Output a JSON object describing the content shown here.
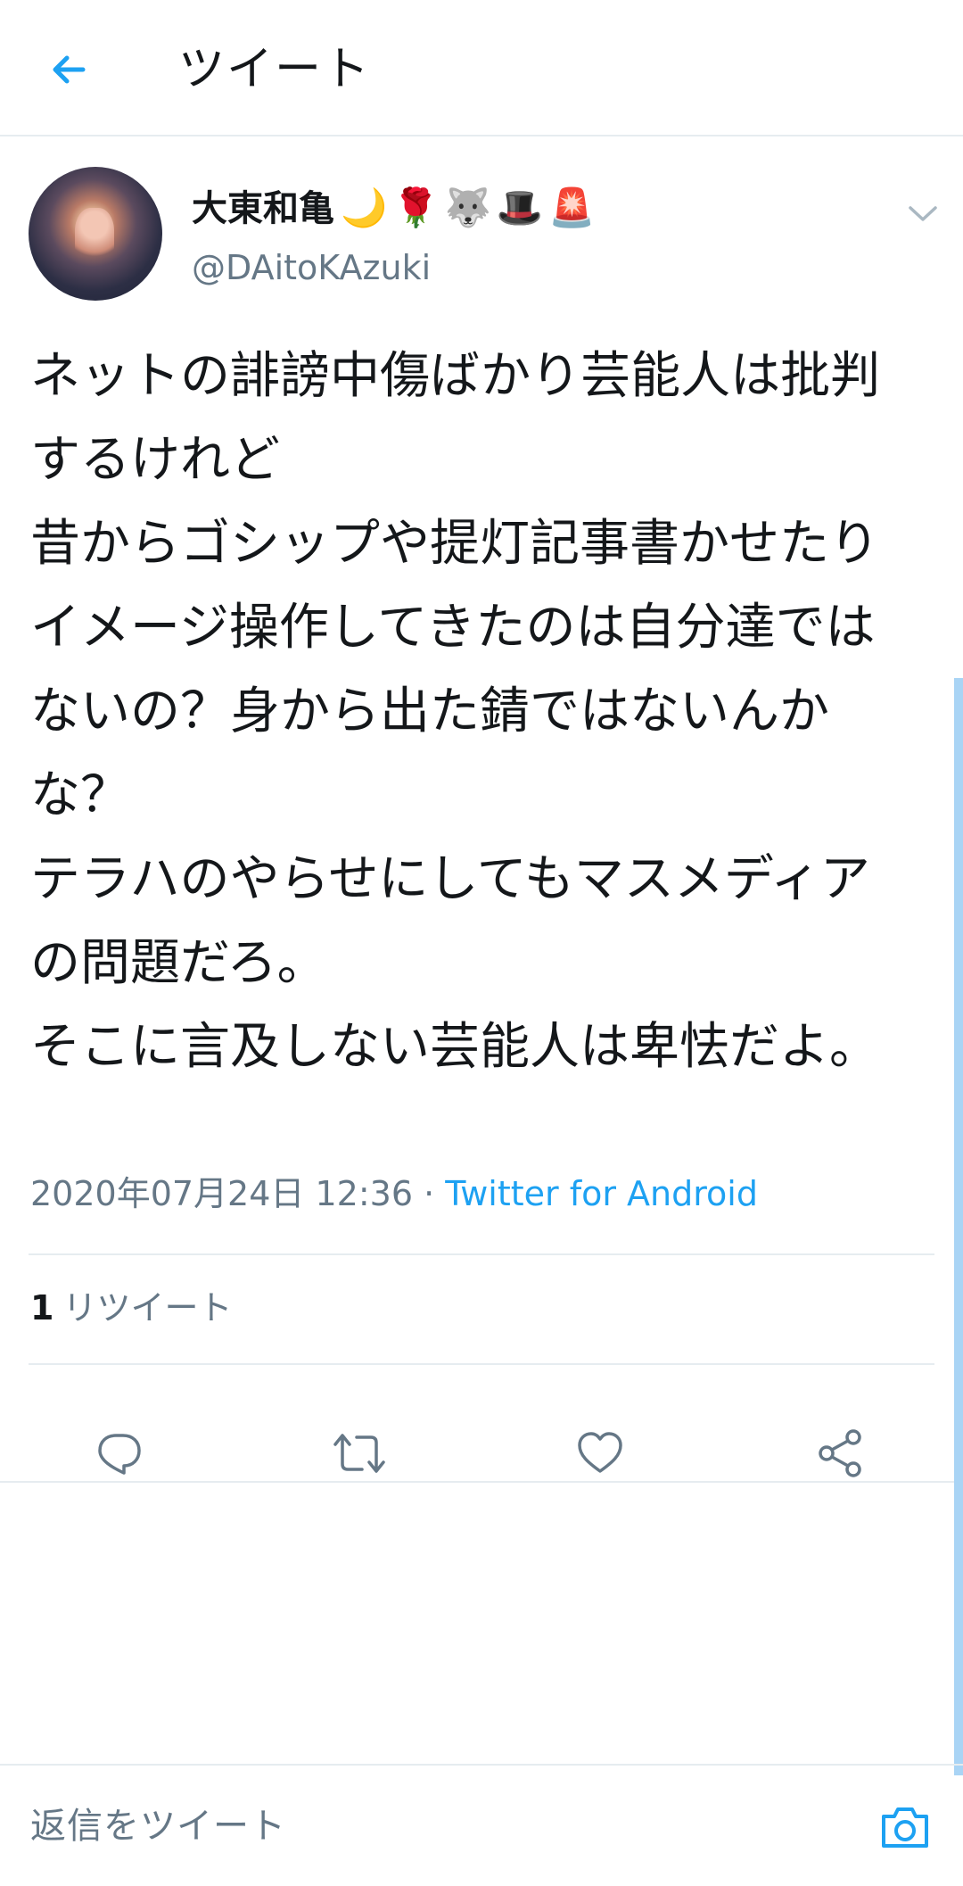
{
  "header": {
    "title": "ツイート"
  },
  "tweet": {
    "author": {
      "display_name": "大東和亀",
      "emojis": [
        "🌙",
        "🌹",
        "🐺",
        "🎩",
        "🚨"
      ],
      "handle": "@DAitoKAzuki"
    },
    "text": "ネットの誹謗中傷ばかり芸能人は批判するけれど\n昔からゴシップや提灯記事書かせたりイメージ操作してきたのは自分達ではないの？身から出た錆ではないんかな？\nテラハのやらせにしてもマスメディアの問題だろ。\nそこに言及しない芸能人は卑怯だよ。",
    "timestamp": "2020年07月24日 12:36",
    "separator": " · ",
    "source": "Twitter for Android",
    "retweet_count": "1",
    "retweet_label": "リツイート"
  },
  "reply_bar": {
    "placeholder": "返信をツイート"
  },
  "colors": {
    "accent": "#1da1f2",
    "secondary_text": "#657786",
    "divider": "#e6ecf0"
  },
  "icons": [
    "back-arrow-icon",
    "chevron-down-icon",
    "reply-icon",
    "retweet-icon",
    "like-icon",
    "share-icon",
    "camera-icon"
  ]
}
